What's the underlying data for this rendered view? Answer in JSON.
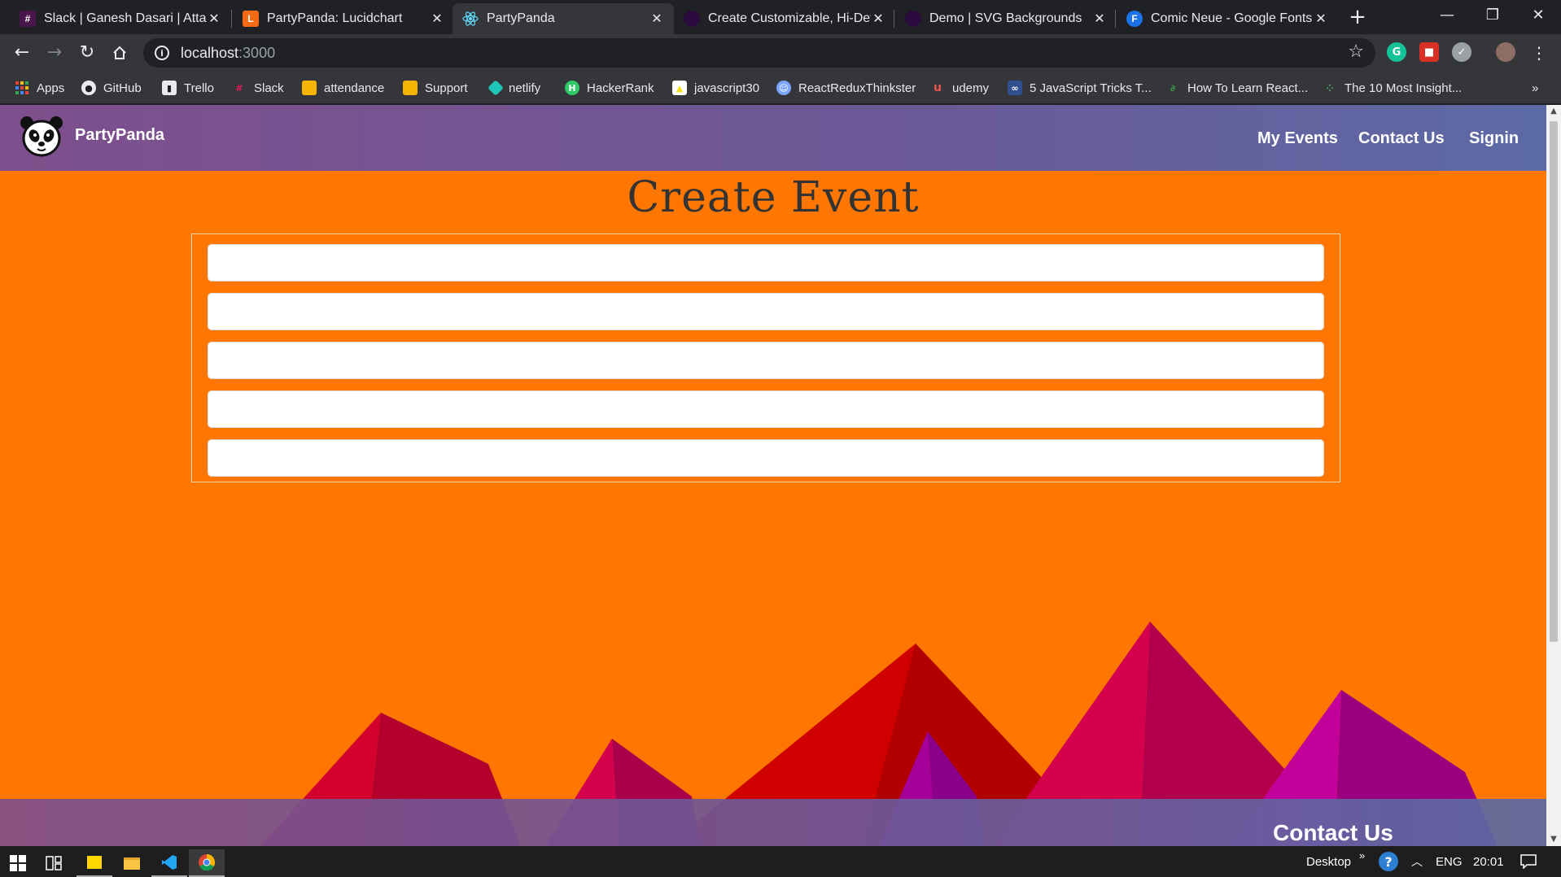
{
  "browser": {
    "tabs": [
      {
        "title": "Slack | Ganesh Dasari | Attain",
        "icon": "slack-icon",
        "active": false
      },
      {
        "title": "PartyPanda: Lucidchart",
        "icon": "lucidchart-icon",
        "active": false
      },
      {
        "title": "PartyPanda",
        "icon": "react-icon",
        "active": true
      },
      {
        "title": "Create Customizable, Hi-Def",
        "icon": "svg-site-icon",
        "active": false
      },
      {
        "title": "Demo | SVG Backgrounds",
        "icon": "svg-site-icon",
        "active": false
      },
      {
        "title": "Comic Neue - Google Fonts",
        "icon": "google-fonts-icon",
        "active": false
      }
    ],
    "tab_close_glyph": "✕",
    "new_tab_glyph": "+",
    "window_controls": {
      "minimize": "—",
      "restore": "❐",
      "close": "✕"
    },
    "address_bar": {
      "host": "localhost",
      "port": ":3000"
    },
    "bookmarks": [
      {
        "label": "Apps",
        "icon": "apps-grid-icon"
      },
      {
        "label": "GitHub",
        "icon": "github-icon"
      },
      {
        "label": "Trello",
        "icon": "trello-icon"
      },
      {
        "label": "Slack",
        "icon": "slack-icon"
      },
      {
        "label": "attendance",
        "icon": "document-icon"
      },
      {
        "label": "Support",
        "icon": "document-icon"
      },
      {
        "label": "netlify",
        "icon": "netlify-icon"
      },
      {
        "label": "HackerRank",
        "icon": "hackerrank-icon"
      },
      {
        "label": "javascript30",
        "icon": "js-icon"
      },
      {
        "label": "ReactReduxThinkster",
        "icon": "thinkster-icon"
      },
      {
        "label": "udemy",
        "icon": "udemy-icon"
      },
      {
        "label": "5 JavaScript Tricks T...",
        "icon": "codeburst-icon"
      },
      {
        "label": "How To Learn React...",
        "icon": "devto-icon"
      },
      {
        "label": "The 10 Most Insight...",
        "icon": "dots-icon"
      }
    ],
    "bookmarks_overflow": "»"
  },
  "page": {
    "brand": "PartyPanda",
    "nav_links": [
      "My Events",
      "Contact Us",
      "Signin"
    ],
    "title": "Create Event",
    "form_field_count": 5,
    "footer_heading": "Contact Us",
    "colors": {
      "background": "#ff7700",
      "navbar_start": "#7e4f8c",
      "navbar_end": "#5c6aa5",
      "mountain_red": "#cc0000",
      "mountain_crimson": "#d4004e",
      "mountain_magenta": "#c4009a"
    }
  },
  "taskbar": {
    "tray_label": "Desktop",
    "overflow": "»",
    "language": "ENG",
    "time": "20:01"
  }
}
